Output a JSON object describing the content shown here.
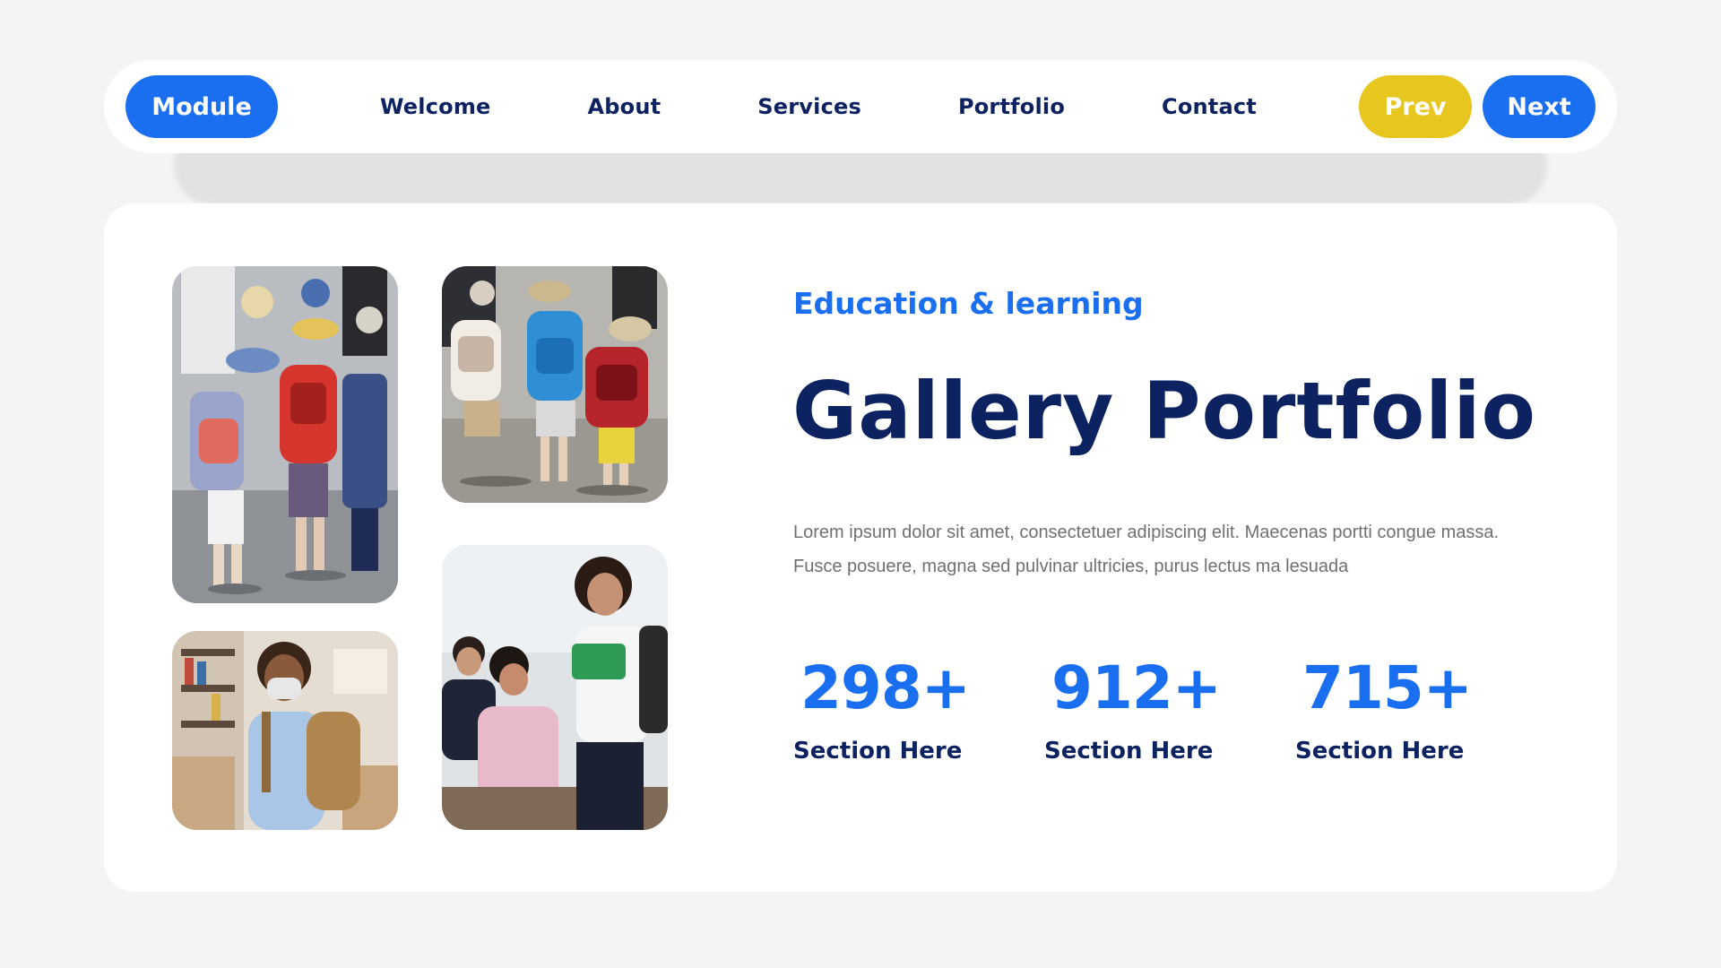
{
  "nav": {
    "module_label": "Module",
    "links": [
      "Welcome",
      "About",
      "Services",
      "Portfolio",
      "Contact"
    ],
    "prev_label": "Prev",
    "next_label": "Next"
  },
  "hero": {
    "subtitle": "Education & learning",
    "title": "Gallery Portfolio",
    "body": "Lorem ipsum dolor sit amet, consectetuer adipiscing elit. Maecenas portti congue massa. Fusce posuere, magna sed pulvinar ultricies, purus lectus ma lesuada"
  },
  "stats": [
    {
      "value": "298+",
      "label": "Section Here"
    },
    {
      "value": "912+",
      "label": "Section Here"
    },
    {
      "value": "715+",
      "label": "Section Here"
    }
  ],
  "colors": {
    "accent_blue": "#1a6ff0",
    "accent_yellow": "#e7c61f",
    "navy": "#0d2260",
    "background": "#f4f4f4"
  }
}
